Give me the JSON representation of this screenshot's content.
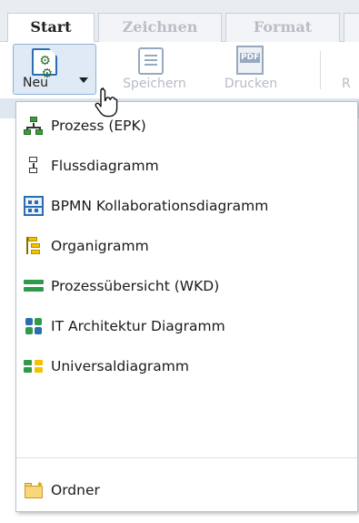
{
  "tabs": [
    {
      "label": "Start",
      "active": true
    },
    {
      "label": "Zeichnen",
      "active": false
    },
    {
      "label": "Format",
      "active": false
    }
  ],
  "ribbon": {
    "new_label": "Neu",
    "save_label": "Speichern",
    "print_label": "Drucken",
    "partial_label": "R",
    "print_icon_text": "PDF"
  },
  "new_menu": {
    "items": [
      {
        "label": "Prozess (EPK)",
        "icon": "epk-process-icon"
      },
      {
        "label": "Flussdiagramm",
        "icon": "flowchart-icon"
      },
      {
        "label": "BPMN Kollaborationsdiagramm",
        "icon": "bpmn-diagram-icon"
      },
      {
        "label": "Organigramm",
        "icon": "org-chart-icon"
      },
      {
        "label": "Prozessübersicht (WKD)",
        "icon": "process-overview-icon"
      },
      {
        "label": "IT Architektur Diagramm",
        "icon": "it-architecture-icon"
      },
      {
        "label": "Universaldiagramm",
        "icon": "universal-diagram-icon"
      },
      {
        "label": "Ordner",
        "icon": "folder-icon"
      }
    ]
  },
  "colors": {
    "accent_blue": "#2a6db3",
    "green": "#2e9a4a",
    "yellow": "#f2c200"
  }
}
